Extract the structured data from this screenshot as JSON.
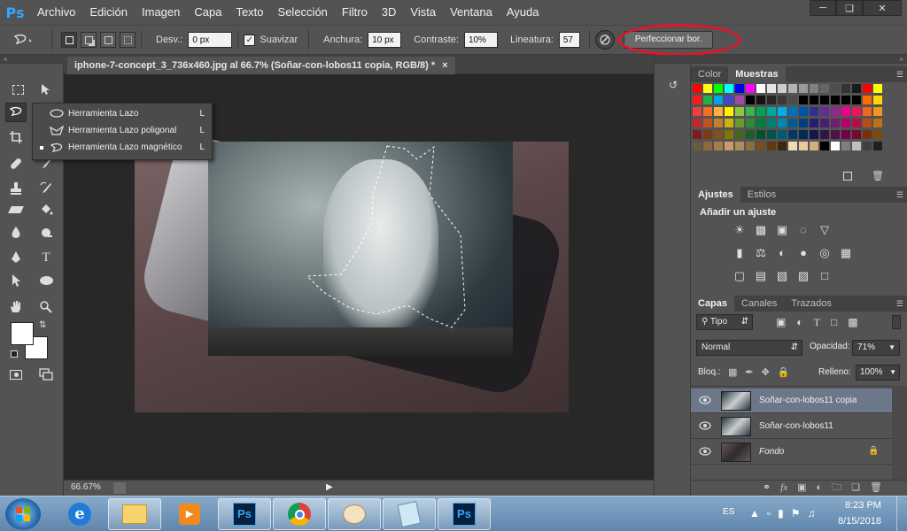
{
  "app": {
    "logo": "Ps"
  },
  "menubar": {
    "items": [
      "Archivo",
      "Edición",
      "Imagen",
      "Capa",
      "Texto",
      "Selección",
      "Filtro",
      "3D",
      "Vista",
      "Ventana",
      "Ayuda"
    ],
    "window_controls": [
      "minimize-icon",
      "restore-icon",
      "close-icon"
    ]
  },
  "options": {
    "desv_label": "Desv.:",
    "desv_value": "0 px",
    "suavizar_label": "Suavizar",
    "suavizar_checked": true,
    "anchura_label": "Anchura:",
    "anchura_value": "10 px",
    "contraste_label": "Contraste:",
    "contraste_value": "10%",
    "lineatura_label": "Lineatura:",
    "lineatura_value": "57",
    "refine_label": "Perfeccionar bor.",
    "highlight_color": "#e8112b"
  },
  "document": {
    "tab_title": "iphone-7-concept_3_736x460.jpg al 66.7% (Soñar-con-lobos11 copia, RGB/8) *",
    "zoom": "66.67%"
  },
  "flyout": {
    "items": [
      {
        "label": "Herramienta Lazo",
        "key": "L",
        "active": false
      },
      {
        "label": "Herramienta Lazo poligonal",
        "key": "L",
        "active": false
      },
      {
        "label": "Herramienta Lazo magnético",
        "key": "L",
        "active": true
      }
    ]
  },
  "panels": {
    "color": {
      "tabs": [
        "Color",
        "Muestras"
      ],
      "active_tab": "Muestras"
    },
    "ajustes": {
      "tabs": [
        "Ajustes",
        "Estilos"
      ],
      "heading": "Añadir un ajuste"
    },
    "layers": {
      "tabs": [
        "Capas",
        "Canales",
        "Trazados"
      ],
      "filter": "Tipo",
      "blend_mode": "Normal",
      "opacity_label": "Opacidad:",
      "opacity": "71%",
      "lock_label": "Bloq.:",
      "fill_label": "Relleno:",
      "fill": "100%",
      "items": [
        {
          "name": "Soñar-con-lobos11 copia",
          "selected": true,
          "locked": false
        },
        {
          "name": "Soñar-con-lobos11",
          "selected": false,
          "locked": false
        },
        {
          "name": "Fondo",
          "selected": false,
          "locked": true
        }
      ]
    }
  },
  "taskbar": {
    "lang": "ES",
    "time": "8:23 PM",
    "date": "8/15/2018",
    "apps": [
      "internet-explorer-icon",
      "file-explorer-icon",
      "media-player-icon",
      "photoshop-icon",
      "chrome-icon",
      "paint-icon",
      "notepad-icon",
      "photoshop-icon"
    ]
  }
}
